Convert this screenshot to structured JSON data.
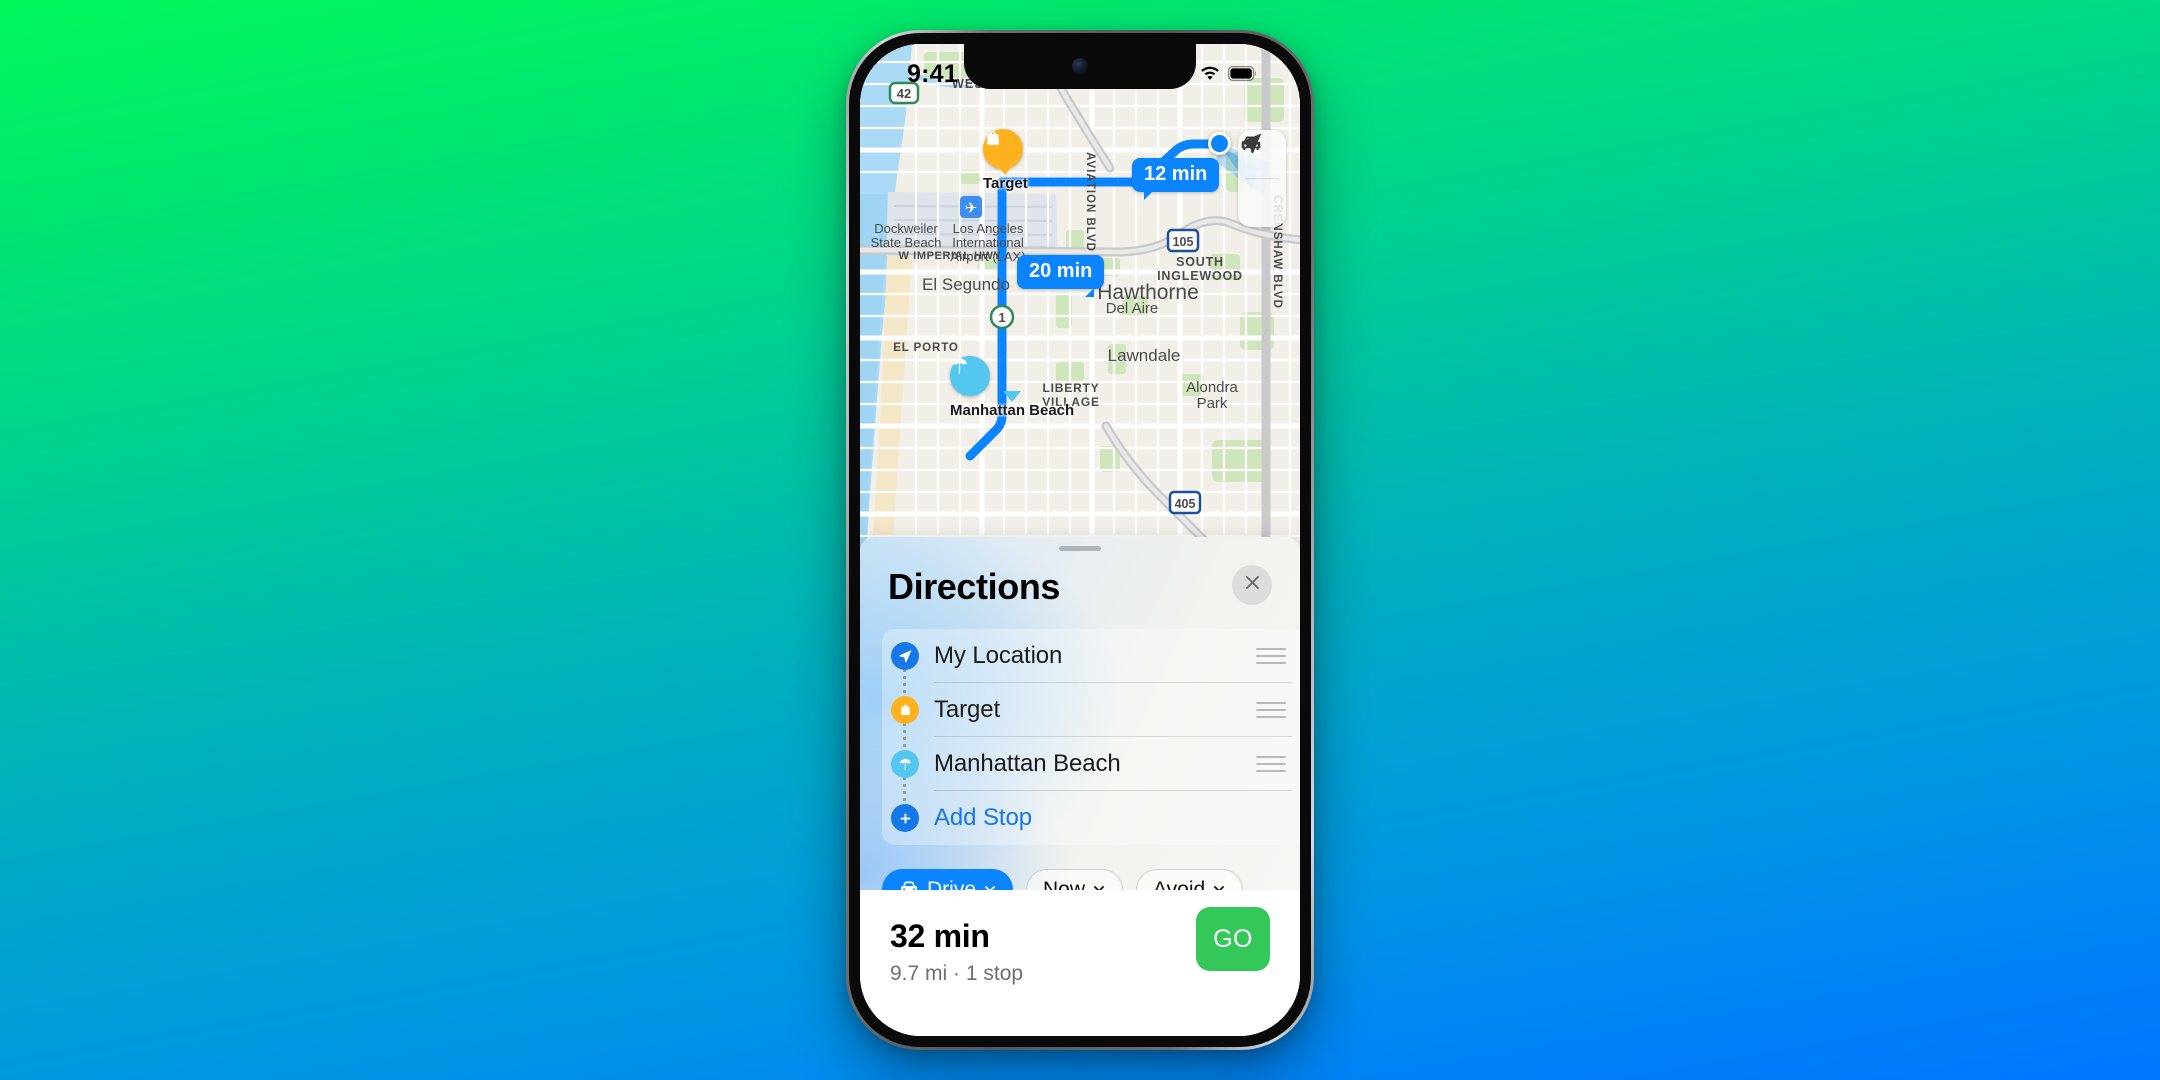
{
  "status_bar": {
    "time": "9:41",
    "location_arrow_icon": "location-arrow-icon",
    "cellular_icon": "cellular-bars-icon",
    "wifi_icon": "wifi-icon",
    "battery_icon": "battery-icon"
  },
  "map": {
    "controls": [
      {
        "icon": "car-icon",
        "name": "map-mode-drive-button"
      },
      {
        "icon": "navigation-arrow-icon",
        "name": "map-recenter-button"
      }
    ],
    "eta_badges": [
      {
        "label": "12 min"
      },
      {
        "label": "20 min"
      }
    ],
    "pins": [
      {
        "caption": "Target",
        "icon": "shopping-bag-icon",
        "color": "#FFB21E"
      },
      {
        "caption": "Manhattan Beach",
        "icon": "beach-umbrella-icon",
        "color": "#53C7F0"
      }
    ],
    "labels": [
      "WESTCHESTER",
      "SOUTH INGLEWOOD",
      "Dockweiler State Beach",
      "Los Angeles International Airport (LAX)",
      "W IMPERIAL HWY",
      "AVIATION BLVD",
      "CRENSHAW BLVD",
      "El Segundo",
      "Hawthorne",
      "Del Aire",
      "EL PORTO",
      "Lawndale",
      "LIBERTY VILLAGE",
      "Alondra Park"
    ],
    "shields": [
      "42",
      "105",
      "1",
      "405"
    ],
    "route_color": "#0a84ff"
  },
  "sheet": {
    "title": "Directions",
    "close_icon": "close-icon",
    "grabber": "sheet-grabber",
    "stops": [
      {
        "label": "My Location",
        "icon": "location-arrow-icon",
        "icon_color": "#1577e8",
        "is_add": false
      },
      {
        "label": "Target",
        "icon": "shopping-bag-icon",
        "icon_color": "#FFB21E",
        "is_add": false
      },
      {
        "label": "Manhattan Beach",
        "icon": "beach-umbrella-icon",
        "icon_color": "#53C7F0",
        "is_add": false
      },
      {
        "label": "Add Stop",
        "icon": "plus-icon",
        "icon_color": "#1577e8",
        "is_add": true
      }
    ],
    "options": [
      {
        "label": "Drive",
        "icon": "car-icon",
        "chevron": "chevron-down-icon",
        "selected": true
      },
      {
        "label": "Now",
        "icon": "",
        "chevron": "chevron-down-icon",
        "selected": false
      },
      {
        "label": "Avoid",
        "icon": "",
        "chevron": "chevron-down-icon",
        "selected": false
      }
    ]
  },
  "summary": {
    "eta": "32 min",
    "details": "9.7 mi · 1 stop",
    "go_label": "GO",
    "go_color": "#34c759"
  }
}
